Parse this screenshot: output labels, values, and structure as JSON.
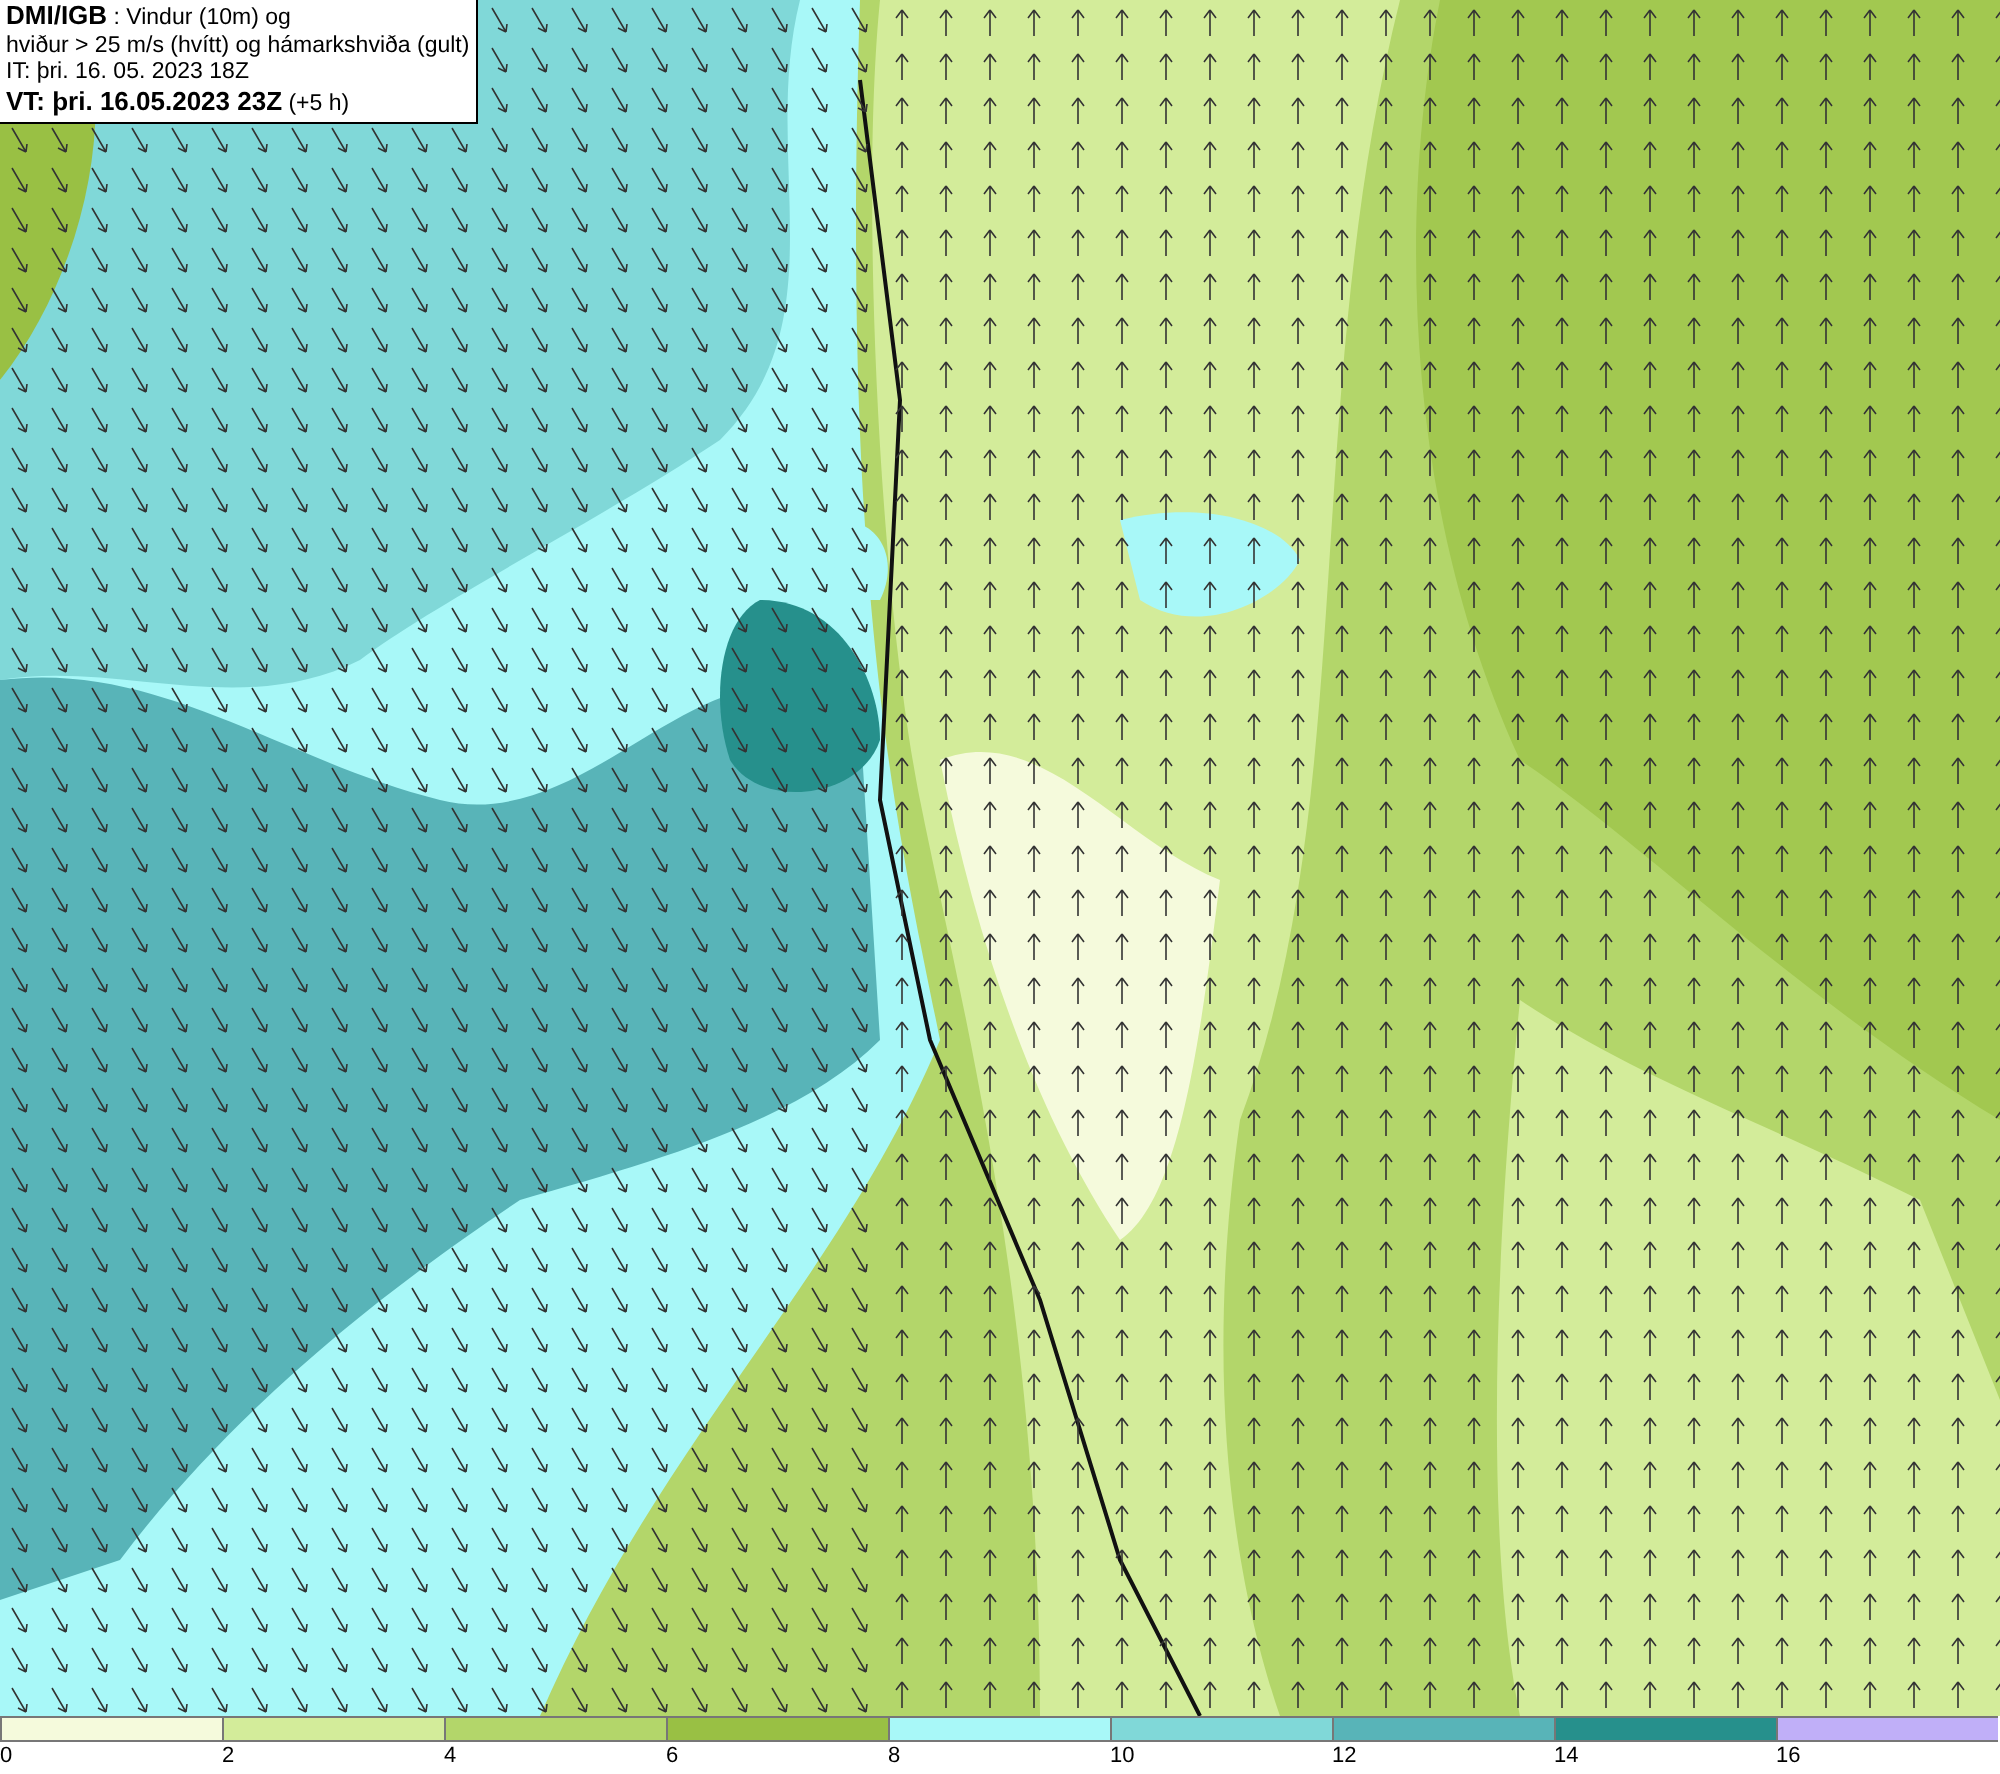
{
  "info_box": {
    "lines": [
      "**DMI/IGB** : Vindur (10m) og",
      "hviður > 25 m/s (hvítt) og hámarkshviða (gult)",
      "IT: þri. 16. 05. 2023 18Z",
      "**VT: þri. 16.05.2023 23Z** (+5 h)"
    ]
  },
  "legend": {
    "bins": [
      {
        "color": "#f5fadc",
        "label": "0"
      },
      {
        "color": "#d3ec9a",
        "label": "2"
      },
      {
        "color": "#b3d66a",
        "label": "4"
      },
      {
        "color": "#99c044",
        "label": "6"
      },
      {
        "color": "#a8f8f8",
        "label": "8"
      },
      {
        "color": "#80d8d8",
        "label": "10"
      },
      {
        "color": "#58b4b8",
        "label": "12"
      },
      {
        "color": "#26908c",
        "label": "14"
      },
      {
        "color": "#c0aff8",
        "label": "16"
      }
    ]
  }
}
